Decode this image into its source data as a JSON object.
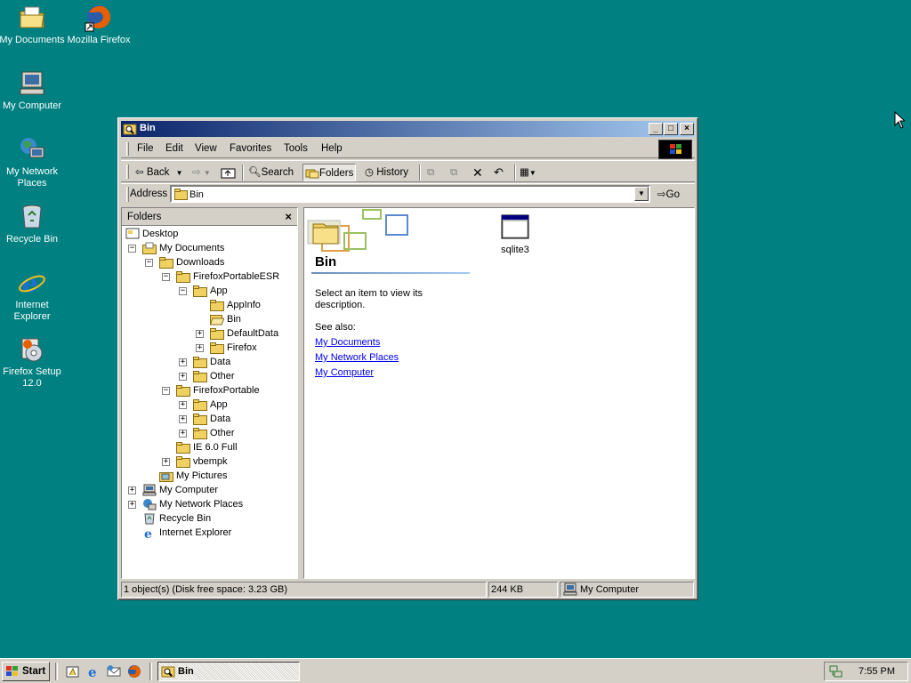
{
  "desktop": {
    "icons": [
      {
        "label": "My Documents",
        "icon": "my-documents-icon"
      },
      {
        "label": "Mozilla Firefox",
        "icon": "firefox-icon"
      },
      {
        "label": "My Computer",
        "icon": "my-computer-icon"
      },
      {
        "label": "My Network Places",
        "icon": "network-places-icon"
      },
      {
        "label": "Recycle Bin",
        "icon": "recycle-bin-icon"
      },
      {
        "label": "Internet Explorer",
        "icon": "internet-explorer-icon"
      },
      {
        "label": "Firefox Setup 12.0",
        "icon": "installer-icon"
      }
    ],
    "background_color": "#008080"
  },
  "window": {
    "title": "Bin",
    "menu": [
      "File",
      "Edit",
      "View",
      "Favorites",
      "Tools",
      "Help"
    ],
    "toolbar": {
      "back": "Back",
      "search": "Search",
      "folders": "Folders",
      "history": "History"
    },
    "address": {
      "label": "Address",
      "value": "Bin",
      "go": "Go"
    },
    "folders_pane": {
      "title": "Folders",
      "close": "×",
      "tree": [
        {
          "label": "Desktop",
          "expander": ""
        },
        {
          "label": "My Documents",
          "expander": "−"
        },
        {
          "label": "Downloads",
          "expander": "−"
        },
        {
          "label": "FirefoxPortableESR",
          "expander": "−"
        },
        {
          "label": "App",
          "expander": "−"
        },
        {
          "label": "AppInfo",
          "expander": ""
        },
        {
          "label": "Bin",
          "expander": ""
        },
        {
          "label": "DefaultData",
          "expander": "+"
        },
        {
          "label": "Firefox",
          "expander": "+"
        },
        {
          "label": "Data",
          "expander": "+"
        },
        {
          "label": "Other",
          "expander": "+"
        },
        {
          "label": "FirefoxPortable",
          "expander": "−"
        },
        {
          "label": "App",
          "expander": "+"
        },
        {
          "label": "Data",
          "expander": "+"
        },
        {
          "label": "Other",
          "expander": "+"
        },
        {
          "label": "IE 6.0 Full",
          "expander": ""
        },
        {
          "label": "vbempk",
          "expander": "+"
        },
        {
          "label": "My Pictures",
          "expander": ""
        },
        {
          "label": "My Computer",
          "expander": "+"
        },
        {
          "label": "My Network Places",
          "expander": "+"
        },
        {
          "label": "Recycle Bin",
          "expander": ""
        },
        {
          "label": "Internet Explorer",
          "expander": ""
        }
      ]
    },
    "content": {
      "folder_title": "Bin",
      "description": "Select an item to view its description.",
      "see_also": "See also:",
      "links": [
        "My Documents",
        "My Network Places",
        "My Computer"
      ],
      "files": [
        {
          "label": "sqlite3",
          "icon": "application-window-icon"
        }
      ]
    },
    "statusbar": {
      "objects": "1 object(s) (Disk free space: 3.23 GB)",
      "size": "244 KB",
      "zone": "My Computer"
    }
  },
  "taskbar": {
    "start": "Start",
    "task": "Bin",
    "clock": "7:55 PM"
  }
}
